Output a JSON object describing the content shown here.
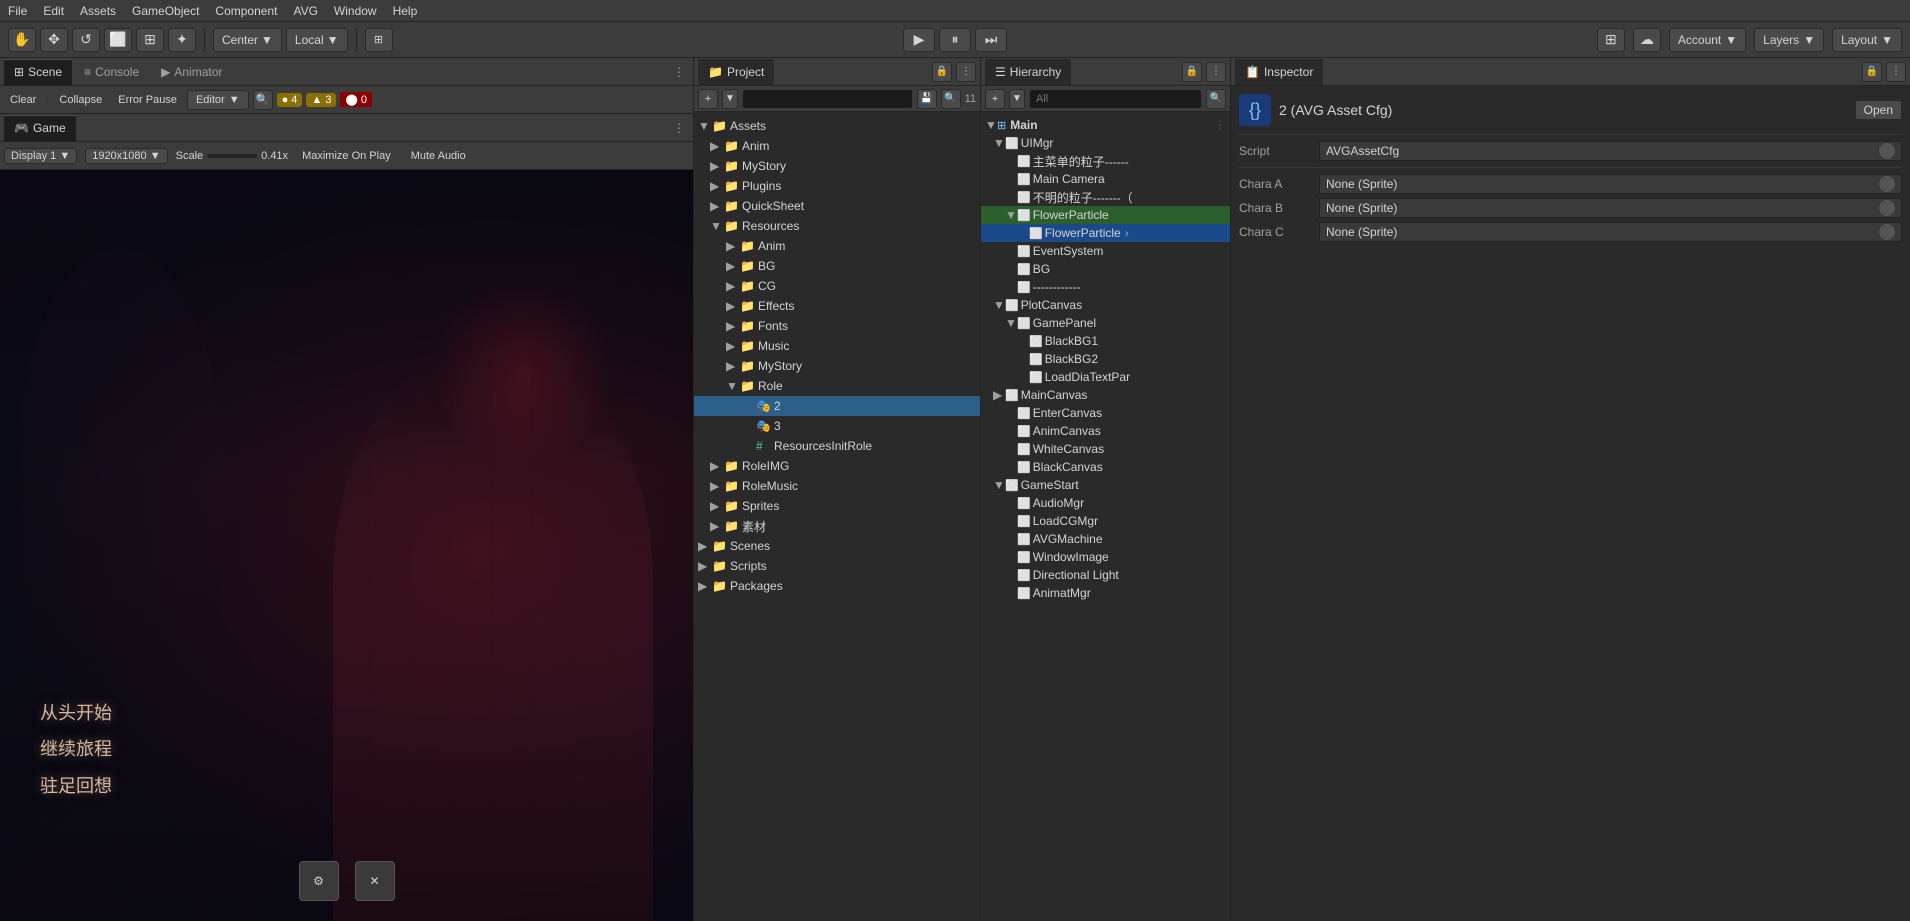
{
  "menubar": {
    "items": [
      "File",
      "Edit",
      "Assets",
      "GameObject",
      "Component",
      "AVG",
      "Window",
      "Help"
    ]
  },
  "toolbar": {
    "tools": [
      "✋",
      "✥",
      "↺",
      "⬜",
      "⊞",
      "✦",
      "⚙"
    ],
    "center_btn": "Center",
    "local_btn": "Local",
    "play_btn": "▶",
    "pause_btn": "⏸",
    "step_btn": "⏭",
    "account_label": "Account",
    "layers_label": "Layers",
    "layout_label": "Layout"
  },
  "scene_panel": {
    "tabs": [
      "Scene",
      "Console",
      "Animator"
    ],
    "active_tab": "Scene",
    "toolbar": {
      "clear_label": "Clear",
      "collapse_label": "Collapse",
      "error_pause_label": "Error Pause",
      "editor_label": "Editor",
      "warn_count": "▲ 3",
      "error_count": "⬤ 0",
      "info_count": "● 4"
    }
  },
  "game_panel": {
    "tab_label": "Game",
    "display_label": "Display 1",
    "resolution_label": "1920x1080",
    "scale_label": "Scale",
    "scale_value": "0.41x",
    "maximize_label": "Maximize On Play",
    "mute_label": "Mute Audio"
  },
  "project_panel": {
    "tab_label": "Project",
    "search_placeholder": "",
    "count_label": "11",
    "tree": [
      {
        "label": "Assets",
        "level": 0,
        "expanded": true,
        "type": "folder",
        "arrow": "▼"
      },
      {
        "label": "Anim",
        "level": 1,
        "expanded": false,
        "type": "folder",
        "arrow": "▶"
      },
      {
        "label": "MyStory",
        "level": 1,
        "expanded": false,
        "type": "folder",
        "arrow": "▶"
      },
      {
        "label": "Plugins",
        "level": 1,
        "expanded": false,
        "type": "folder",
        "arrow": "▶"
      },
      {
        "label": "QuickSheet",
        "level": 1,
        "expanded": false,
        "type": "folder",
        "arrow": "▶"
      },
      {
        "label": "Resources",
        "level": 1,
        "expanded": true,
        "type": "folder",
        "arrow": "▼"
      },
      {
        "label": "Anim",
        "level": 2,
        "expanded": false,
        "type": "folder",
        "arrow": "▶"
      },
      {
        "label": "BG",
        "level": 2,
        "expanded": false,
        "type": "folder",
        "arrow": "▶"
      },
      {
        "label": "CG",
        "level": 2,
        "expanded": false,
        "type": "folder",
        "arrow": "▶"
      },
      {
        "label": "Effects",
        "level": 2,
        "expanded": false,
        "type": "folder",
        "arrow": "▶"
      },
      {
        "label": "Fonts",
        "level": 2,
        "expanded": false,
        "type": "folder",
        "arrow": "▶"
      },
      {
        "label": "Music",
        "level": 2,
        "expanded": false,
        "type": "folder",
        "arrow": "▶"
      },
      {
        "label": "MyStory",
        "level": 2,
        "expanded": false,
        "type": "folder",
        "arrow": "▶"
      },
      {
        "label": "Role",
        "level": 2,
        "expanded": true,
        "type": "folder",
        "arrow": "▼"
      },
      {
        "label": "2",
        "level": 3,
        "expanded": false,
        "type": "asset",
        "selected": true
      },
      {
        "label": "3",
        "level": 3,
        "expanded": false,
        "type": "asset"
      },
      {
        "label": "ResourcesInitRole",
        "level": 3,
        "expanded": false,
        "type": "script"
      },
      {
        "label": "RoleIMG",
        "level": 1,
        "expanded": false,
        "type": "folder",
        "arrow": "▶"
      },
      {
        "label": "RoleMusic",
        "level": 1,
        "expanded": false,
        "type": "folder",
        "arrow": "▶"
      },
      {
        "label": "Sprites",
        "level": 1,
        "expanded": false,
        "type": "folder",
        "arrow": "▶"
      },
      {
        "label": "素材",
        "level": 1,
        "expanded": false,
        "type": "folder",
        "arrow": "▶"
      },
      {
        "label": "Scenes",
        "level": 0,
        "expanded": false,
        "type": "folder",
        "arrow": "▶"
      },
      {
        "label": "Scripts",
        "level": 0,
        "expanded": false,
        "type": "folder",
        "arrow": "▶"
      },
      {
        "label": "Packages",
        "level": 0,
        "expanded": false,
        "type": "folder",
        "arrow": "▶"
      }
    ]
  },
  "hierarchy_panel": {
    "title": "Hierarchy",
    "search_placeholder": "All",
    "scene_name": "Main",
    "items": [
      {
        "label": "UIMgr",
        "level": 1,
        "type": "cube",
        "arrow": "▼",
        "expanded": true
      },
      {
        "label": "主菜单的粒子------",
        "level": 2,
        "type": "cube"
      },
      {
        "label": "Main Camera",
        "level": 2,
        "type": "cube",
        "note": ""
      },
      {
        "label": "不明的粒子-------（",
        "level": 2,
        "type": "cube"
      },
      {
        "label": "FlowerParticle",
        "level": 2,
        "type": "cube",
        "arrow": "▼",
        "expanded": true,
        "highlighted": true
      },
      {
        "label": "FlowerParticle",
        "level": 3,
        "type": "cube",
        "active": true
      },
      {
        "label": "EventSystem",
        "level": 2,
        "type": "cube"
      },
      {
        "label": "BG",
        "level": 2,
        "type": "cube"
      },
      {
        "label": "------------",
        "level": 2,
        "type": "cube"
      },
      {
        "label": "PlotCanvas",
        "level": 1,
        "type": "cube",
        "arrow": "▼",
        "expanded": true
      },
      {
        "label": "GamePanel",
        "level": 2,
        "type": "cube",
        "arrow": "▼",
        "expanded": true
      },
      {
        "label": "BlackBG1",
        "level": 3,
        "type": "cube"
      },
      {
        "label": "BlackBG2",
        "level": 3,
        "type": "cube"
      },
      {
        "label": "LoadDiaTextPar",
        "level": 3,
        "type": "cube"
      },
      {
        "label": "MainCanvas",
        "level": 1,
        "type": "cube",
        "arrow": "▶"
      },
      {
        "label": "EnterCanvas",
        "level": 2,
        "type": "cube"
      },
      {
        "label": "AnimCanvas",
        "level": 2,
        "type": "cube"
      },
      {
        "label": "WhiteCanvas",
        "level": 2,
        "type": "cube"
      },
      {
        "label": "BlackCanvas",
        "level": 2,
        "type": "cube"
      },
      {
        "label": "GameStart",
        "level": 1,
        "type": "cube",
        "arrow": "▼",
        "expanded": true
      },
      {
        "label": "AudioMgr",
        "level": 2,
        "type": "cube"
      },
      {
        "label": "LoadCGMgr",
        "level": 2,
        "type": "cube"
      },
      {
        "label": "AVGMachine",
        "level": 2,
        "type": "cube"
      },
      {
        "label": "WindowImage",
        "level": 2,
        "type": "cube"
      },
      {
        "label": "Directional Light",
        "level": 2,
        "type": "cube"
      },
      {
        "label": "AnimatMgr",
        "level": 2,
        "type": "cube"
      }
    ]
  },
  "inspector_panel": {
    "tab_label": "Inspector",
    "title": "2 (AVG Asset Cfg)",
    "open_btn": "Open",
    "script_label": "Script",
    "script_value": "AVGAssetCfg",
    "chara_a_label": "Chara A",
    "chara_a_value": "None (Sprite)",
    "chara_b_label": "Chara B",
    "chara_b_value": "None (Sprite)",
    "chara_c_label": "Chara C",
    "chara_c_value": "None (Sprite)"
  },
  "game_overlay": {
    "line1": "从头开始",
    "line2": "继续旅程",
    "line3": "驻足回想"
  }
}
